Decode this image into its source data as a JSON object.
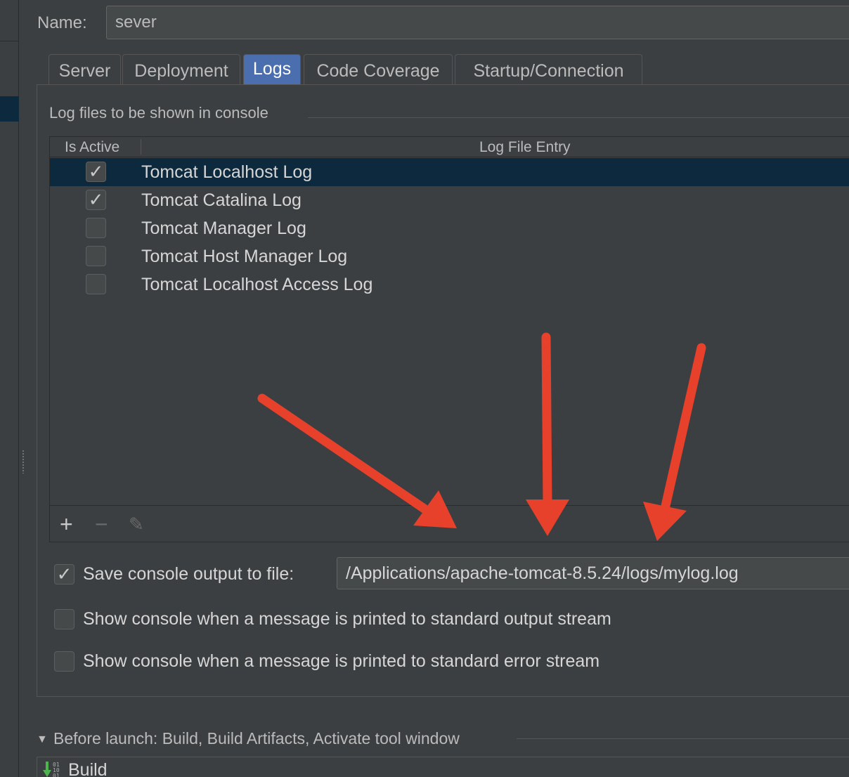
{
  "name_field": {
    "label": "Name:",
    "value": "sever"
  },
  "tabs": [
    {
      "label": "Server",
      "active": false
    },
    {
      "label": "Deployment",
      "active": false
    },
    {
      "label": "Logs",
      "active": true
    },
    {
      "label": "Code Coverage",
      "active": false
    },
    {
      "label": "Startup/Connection",
      "active": false
    }
  ],
  "log_files": {
    "group_title": "Log files to be shown in console",
    "columns": {
      "is_active": "Is Active",
      "entry": "Log File Entry"
    },
    "rows": [
      {
        "active": true,
        "entry": "Tomcat Localhost Log"
      },
      {
        "active": true,
        "entry": "Tomcat Catalina Log"
      },
      {
        "active": false,
        "entry": "Tomcat Manager Log"
      },
      {
        "active": false,
        "entry": "Tomcat Host Manager Log"
      },
      {
        "active": false,
        "entry": "Tomcat Localhost Access Log"
      }
    ],
    "toolbar": {
      "add_glyph": "+",
      "remove_glyph": "−",
      "edit_glyph": "✎"
    }
  },
  "options": {
    "save_console": {
      "checked": true,
      "label": "Save console output to file:",
      "path": "/Applications/apache-tomcat-8.5.24/logs/mylog.log"
    },
    "show_stdout": {
      "checked": false,
      "label": "Show console when a message is printed to standard output stream"
    },
    "show_stderr": {
      "checked": false,
      "label": "Show console when a message is printed to standard error stream"
    }
  },
  "before_launch": {
    "title": "Before launch: Build, Build Artifacts, Activate tool window",
    "items": [
      {
        "icon": "build-icon",
        "label": "Build"
      }
    ]
  },
  "colors": {
    "background": "#3c3f41",
    "selection": "#0d293e",
    "active_tab": "#4b6eaf",
    "annotation_arrow": "#e8412b"
  }
}
